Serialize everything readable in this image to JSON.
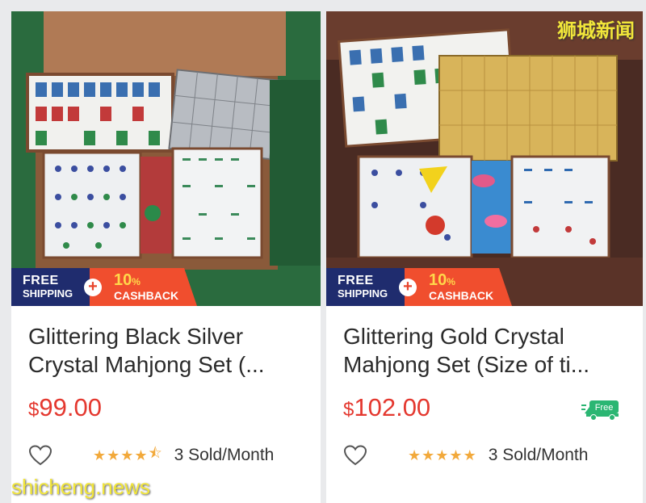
{
  "products": [
    {
      "title_line1": "Glittering Black Silver",
      "title_line2": "Crystal Mahjong Set (...",
      "currency": "$",
      "price": "99.00",
      "rating": 4.5,
      "sold": "3 Sold/Month",
      "promo": {
        "free": "FREE",
        "shipping": "SHIPPING",
        "plus": "+",
        "pct": "10",
        "pct_sign": "%",
        "cashback": "CASHBACK"
      },
      "tile_color": "#b8bcc2"
    },
    {
      "title_line1": "Glittering Gold Crystal",
      "title_line2": "Mahjong Set (Size of ti...",
      "currency": "$",
      "price": "102.00",
      "rating": 5,
      "sold": "3 Sold/Month",
      "free_badge": "Free",
      "promo": {
        "free": "FREE",
        "shipping": "SHIPPING",
        "plus": "+",
        "pct": "10",
        "pct_sign": "%",
        "cashback": "CASHBACK"
      },
      "tile_color": "#d8b45a"
    }
  ],
  "watermarks": {
    "top": "狮城新闻",
    "bottom": "shicheng.news"
  },
  "colors": {
    "price": "#e4382f",
    "star": "#f2a93b",
    "promo_blue": "#1f2c6e",
    "promo_orange": "#f04e2e",
    "free_green": "#2bb673"
  }
}
